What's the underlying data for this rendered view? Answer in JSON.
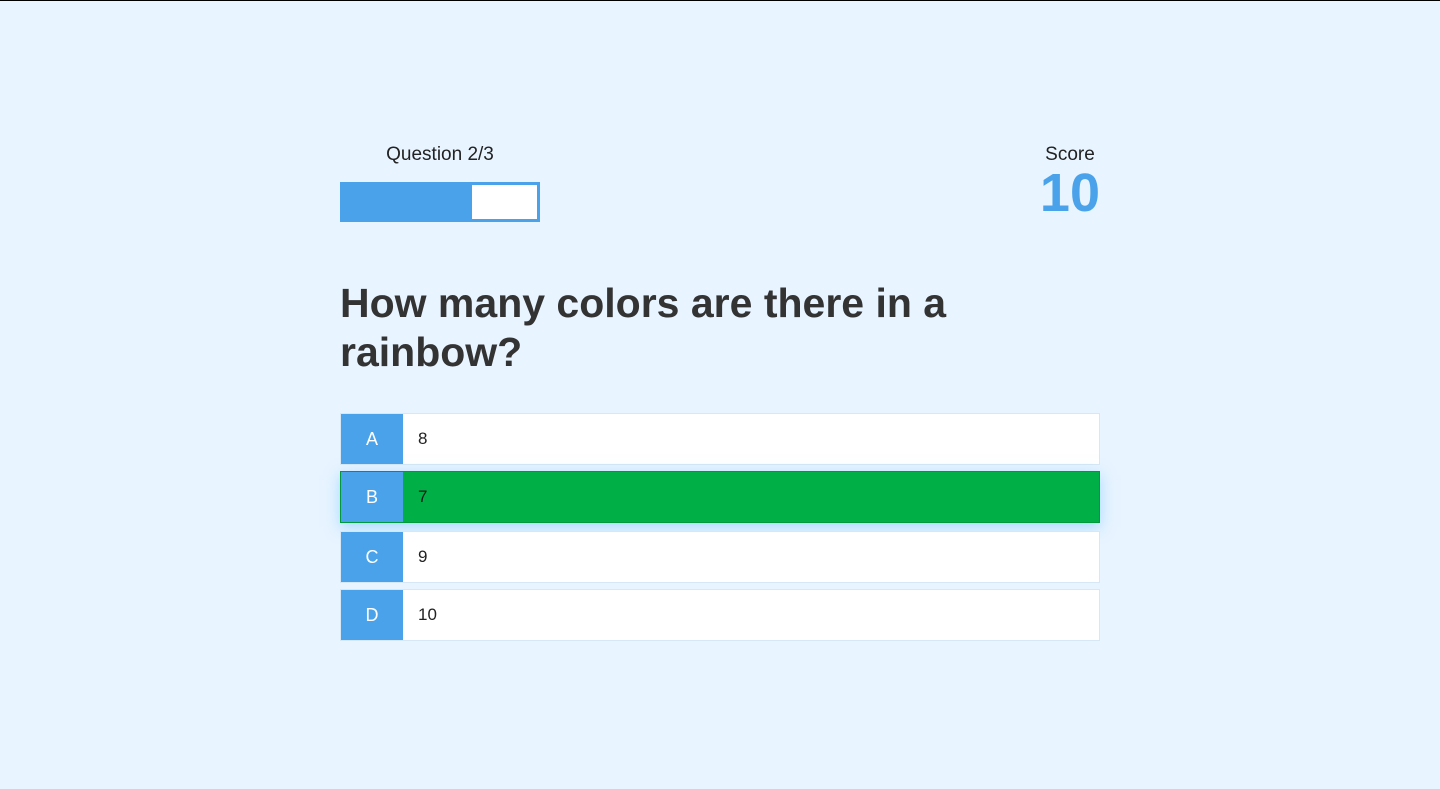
{
  "hud": {
    "progress_text": "Question 2/3",
    "progress_fraction": 0.666,
    "score_label": "Score",
    "score_value": "10"
  },
  "question": {
    "text": "How many colors are there in a rainbow?"
  },
  "choices": [
    {
      "prefix": "A",
      "text": "8",
      "state": "default"
    },
    {
      "prefix": "B",
      "text": "7",
      "state": "correct"
    },
    {
      "prefix": "C",
      "text": "9",
      "state": "default"
    },
    {
      "prefix": "D",
      "text": "10",
      "state": "default"
    }
  ],
  "colors": {
    "accent": "#4aa3ea",
    "correct": "#00b046",
    "background": "#e8f4ff"
  }
}
